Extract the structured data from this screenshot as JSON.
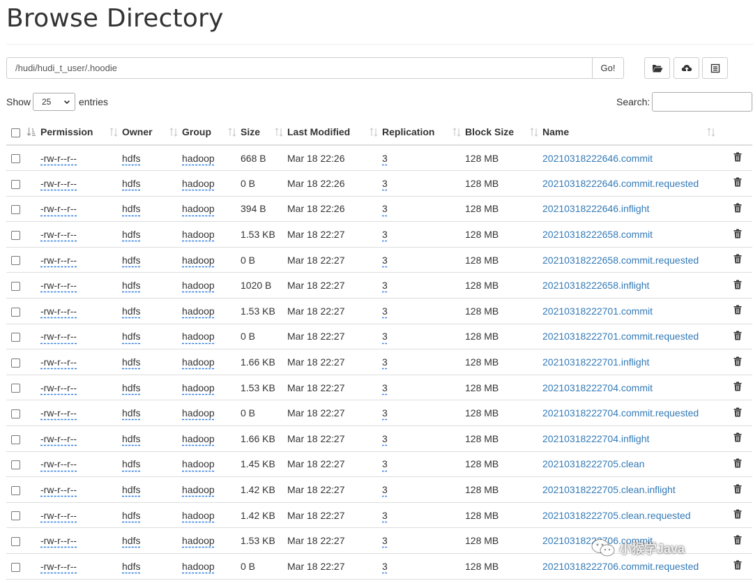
{
  "page": {
    "title": "Browse Directory"
  },
  "pathbar": {
    "path": "/hudi/hudi_t_user/.hoodie",
    "go_label": "Go!"
  },
  "toolbar": {
    "icons": [
      "folder-open-icon",
      "upload-icon",
      "list-icon"
    ]
  },
  "length": {
    "show_label": "Show",
    "value": "25",
    "entries_label": "entries"
  },
  "search": {
    "label": "Search:",
    "value": ""
  },
  "table": {
    "columns": [
      "Permission",
      "Owner",
      "Group",
      "Size",
      "Last Modified",
      "Replication",
      "Block Size",
      "Name"
    ],
    "rows": [
      {
        "permission": "-rw-r--r--",
        "owner": "hdfs",
        "group": "hadoop",
        "size": "668 B",
        "modified": "Mar 18 22:26",
        "replication": "3",
        "block_size": "128 MB",
        "name": "20210318222646.commit"
      },
      {
        "permission": "-rw-r--r--",
        "owner": "hdfs",
        "group": "hadoop",
        "size": "0 B",
        "modified": "Mar 18 22:26",
        "replication": "3",
        "block_size": "128 MB",
        "name": "20210318222646.commit.requested"
      },
      {
        "permission": "-rw-r--r--",
        "owner": "hdfs",
        "group": "hadoop",
        "size": "394 B",
        "modified": "Mar 18 22:26",
        "replication": "3",
        "block_size": "128 MB",
        "name": "20210318222646.inflight"
      },
      {
        "permission": "-rw-r--r--",
        "owner": "hdfs",
        "group": "hadoop",
        "size": "1.53 KB",
        "modified": "Mar 18 22:27",
        "replication": "3",
        "block_size": "128 MB",
        "name": "20210318222658.commit"
      },
      {
        "permission": "-rw-r--r--",
        "owner": "hdfs",
        "group": "hadoop",
        "size": "0 B",
        "modified": "Mar 18 22:27",
        "replication": "3",
        "block_size": "128 MB",
        "name": "20210318222658.commit.requested"
      },
      {
        "permission": "-rw-r--r--",
        "owner": "hdfs",
        "group": "hadoop",
        "size": "1020 B",
        "modified": "Mar 18 22:27",
        "replication": "3",
        "block_size": "128 MB",
        "name": "20210318222658.inflight"
      },
      {
        "permission": "-rw-r--r--",
        "owner": "hdfs",
        "group": "hadoop",
        "size": "1.53 KB",
        "modified": "Mar 18 22:27",
        "replication": "3",
        "block_size": "128 MB",
        "name": "20210318222701.commit"
      },
      {
        "permission": "-rw-r--r--",
        "owner": "hdfs",
        "group": "hadoop",
        "size": "0 B",
        "modified": "Mar 18 22:27",
        "replication": "3",
        "block_size": "128 MB",
        "name": "20210318222701.commit.requested"
      },
      {
        "permission": "-rw-r--r--",
        "owner": "hdfs",
        "group": "hadoop",
        "size": "1.66 KB",
        "modified": "Mar 18 22:27",
        "replication": "3",
        "block_size": "128 MB",
        "name": "20210318222701.inflight"
      },
      {
        "permission": "-rw-r--r--",
        "owner": "hdfs",
        "group": "hadoop",
        "size": "1.53 KB",
        "modified": "Mar 18 22:27",
        "replication": "3",
        "block_size": "128 MB",
        "name": "20210318222704.commit"
      },
      {
        "permission": "-rw-r--r--",
        "owner": "hdfs",
        "group": "hadoop",
        "size": "0 B",
        "modified": "Mar 18 22:27",
        "replication": "3",
        "block_size": "128 MB",
        "name": "20210318222704.commit.requested"
      },
      {
        "permission": "-rw-r--r--",
        "owner": "hdfs",
        "group": "hadoop",
        "size": "1.66 KB",
        "modified": "Mar 18 22:27",
        "replication": "3",
        "block_size": "128 MB",
        "name": "20210318222704.inflight"
      },
      {
        "permission": "-rw-r--r--",
        "owner": "hdfs",
        "group": "hadoop",
        "size": "1.45 KB",
        "modified": "Mar 18 22:27",
        "replication": "3",
        "block_size": "128 MB",
        "name": "20210318222705.clean"
      },
      {
        "permission": "-rw-r--r--",
        "owner": "hdfs",
        "group": "hadoop",
        "size": "1.42 KB",
        "modified": "Mar 18 22:27",
        "replication": "3",
        "block_size": "128 MB",
        "name": "20210318222705.clean.inflight"
      },
      {
        "permission": "-rw-r--r--",
        "owner": "hdfs",
        "group": "hadoop",
        "size": "1.42 KB",
        "modified": "Mar 18 22:27",
        "replication": "3",
        "block_size": "128 MB",
        "name": "20210318222705.clean.requested"
      },
      {
        "permission": "-rw-r--r--",
        "owner": "hdfs",
        "group": "hadoop",
        "size": "1.53 KB",
        "modified": "Mar 18 22:27",
        "replication": "3",
        "block_size": "128 MB",
        "name": "20210318222706.commit"
      },
      {
        "permission": "-rw-r--r--",
        "owner": "hdfs",
        "group": "hadoop",
        "size": "0 B",
        "modified": "Mar 18 22:27",
        "replication": "3",
        "block_size": "128 MB",
        "name": "20210318222706.commit.requested"
      }
    ]
  },
  "watermark": {
    "text": "小猴学Java"
  },
  "colors": {
    "link": "#337ab7",
    "border": "#dddddd",
    "text": "#333333"
  }
}
